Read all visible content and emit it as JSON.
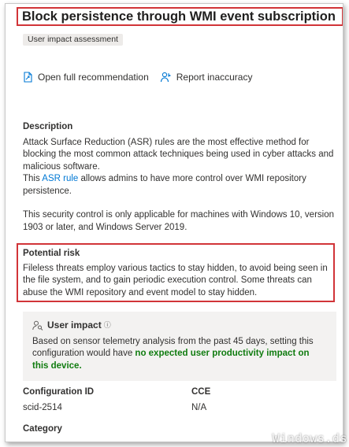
{
  "header": {
    "title": "Block persistence through WMI event subscription",
    "tag": "User impact assessment"
  },
  "actions": {
    "open_label": "Open full recommendation",
    "report_label": "Report inaccuracy"
  },
  "description": {
    "heading": "Description",
    "line1": "Attack Surface Reduction (ASR) rules are the most effective method for blocking the most common attack techniques being used in cyber attacks and malicious software.",
    "line2_pre": "This ",
    "line2_link": "ASR rule",
    "line2_post": " allows admins to have more control over WMI repository persistence.",
    "line3": "This security control is only applicable for machines with Windows 10, version 1903 or later, and Windows Server 2019."
  },
  "potential_risk": {
    "heading": "Potential risk",
    "text": "Fileless threats employ various tactics to stay hidden, to avoid being seen in the file system, and to gain periodic execution control. Some threats can abuse the WMI repository and event model to stay hidden."
  },
  "user_impact": {
    "heading": "User impact",
    "info_glyph": "ⓘ",
    "text_pre": "Based on sensor telemetry analysis from the past 45 days, setting this configuration would have ",
    "text_highlight": "no expected user productivity impact on this device.",
    "highlight_color": "#107c10"
  },
  "details": {
    "config_label": "Configuration ID",
    "config_value": "scid-2514",
    "cce_label": "CCE",
    "cce_value": "N/A",
    "category_label": "Category"
  },
  "watermark": "Windows.ds"
}
